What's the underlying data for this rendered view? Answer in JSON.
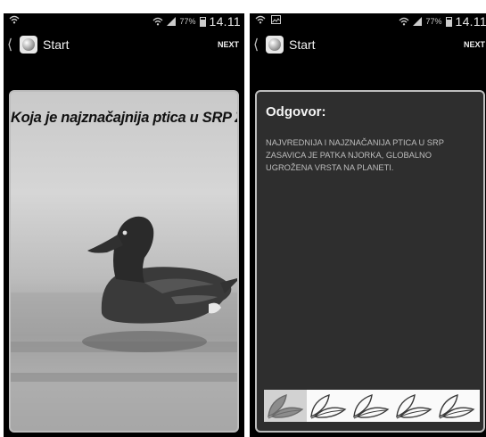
{
  "screens": [
    {
      "status": {
        "battery": "77%",
        "time": "14.11",
        "wifi_icon": "wifi-icon",
        "signal_icon": "signal-icon"
      },
      "action_bar": {
        "title": "Start",
        "next_label": "NEXT"
      },
      "question": "Koja je najznačajnija ptica u SRP Zasavica?"
    },
    {
      "status": {
        "battery": "77%",
        "time": "14.11",
        "image_notification_icon": "image-notification-icon"
      },
      "action_bar": {
        "title": "Start",
        "next_label": "NEXT"
      },
      "answer": {
        "title": "Odgovor:",
        "body": "NAJVREDNIJA I NAJZNAČANIJA PTICA U SRP ZASAVICA JE PATKA NJORKA, GLOBALNO UGROŽENA VRSTA NA PLANETI."
      },
      "rating": {
        "max": 5,
        "value": 1,
        "icon": "leaf-icon"
      }
    }
  ],
  "colors": {
    "background": "#000000",
    "answer_card": "#2e2e2e",
    "answer_text": "#bdbdbd"
  }
}
